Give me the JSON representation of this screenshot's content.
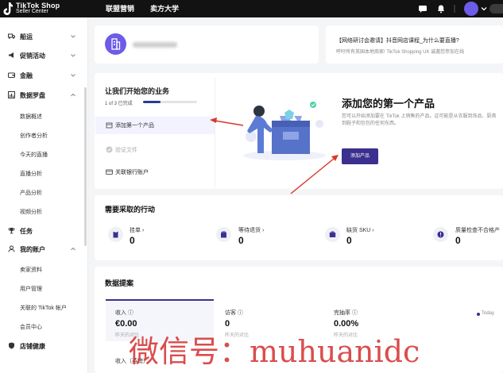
{
  "brand": {
    "line1": "TikTok Shop",
    "line2": "Seller Center"
  },
  "topnav": [
    {
      "label": "联盟营销"
    },
    {
      "label": "卖方大学"
    }
  ],
  "sidebar": {
    "items": [
      {
        "label": "船运",
        "icon": "truck-icon"
      },
      {
        "label": "促销活动",
        "icon": "megaphone-icon"
      },
      {
        "label": "金融",
        "icon": "wallet-icon"
      },
      {
        "label": "数据罗盘",
        "icon": "chart-icon"
      },
      {
        "label": "任务",
        "icon": "trophy-icon"
      },
      {
        "label": "我的账户",
        "icon": "user-icon"
      },
      {
        "label": "店铺健康",
        "icon": "shield-icon"
      }
    ],
    "data_compass_sub": [
      "数据概述",
      "创作者分析",
      "今天的直播",
      "直播分析",
      "产品分析",
      "视频分析"
    ],
    "account_sub": [
      "卖家资料",
      "用户管理",
      "关联的 TikTok 帐户",
      "会员中心"
    ]
  },
  "notice": {
    "title": "【网络研讨会邀请】抖音网店课程_为什么要直播?",
    "body": "呼吁所有英国本地商家! TikTok Shopping UK 诚邀您参加在线"
  },
  "onboarding": {
    "title": "让我们开始您的业务",
    "progress_text": "1 of 3 已完成",
    "progress_fraction": 0.33,
    "steps": [
      {
        "label": "添加第一个产品",
        "state": "active"
      },
      {
        "label": "验证文件",
        "state": "done"
      },
      {
        "label": "关联银行账户",
        "state": "todo"
      }
    ],
    "headline": "添加您的第一个产品",
    "description": "您可以开始添加要在 TikTok 上销售的产品。这可能是从衣服到饰品、厨具到鞋子和包包的任何东西。",
    "button_label": "添加产品"
  },
  "actions": {
    "title": "需要采取的行动",
    "items": [
      {
        "label": "挂单 ›",
        "value": "0",
        "icon": "clipboard-icon"
      },
      {
        "label": "等待退货 ›",
        "value": "0",
        "icon": "return-box-icon"
      },
      {
        "label": "缺货 SKU ›",
        "value": "0",
        "icon": "stock-icon"
      },
      {
        "label": "质量检查不合格产",
        "value": "0",
        "icon": "quality-check-icon"
      }
    ]
  },
  "insights": {
    "title": "数据提案",
    "metrics": [
      {
        "label": "收入 ⓘ",
        "value": "€0.00",
        "sub": "昨天的对比"
      },
      {
        "label": "访客 ⓘ",
        "value": "0",
        "sub": "昨天的对比"
      },
      {
        "label": "完抽率 ⓘ",
        "value": "0.00%",
        "sub": "昨天的对比"
      }
    ],
    "chart_label": "收入（英镑）",
    "legend_today": "Today"
  },
  "watermark": "微信号：muhuanidc",
  "colors": {
    "topbar": "#121212",
    "accent": "#3b2f8f",
    "avatar": "#6c5ce7",
    "arrow": "#d9362b"
  }
}
